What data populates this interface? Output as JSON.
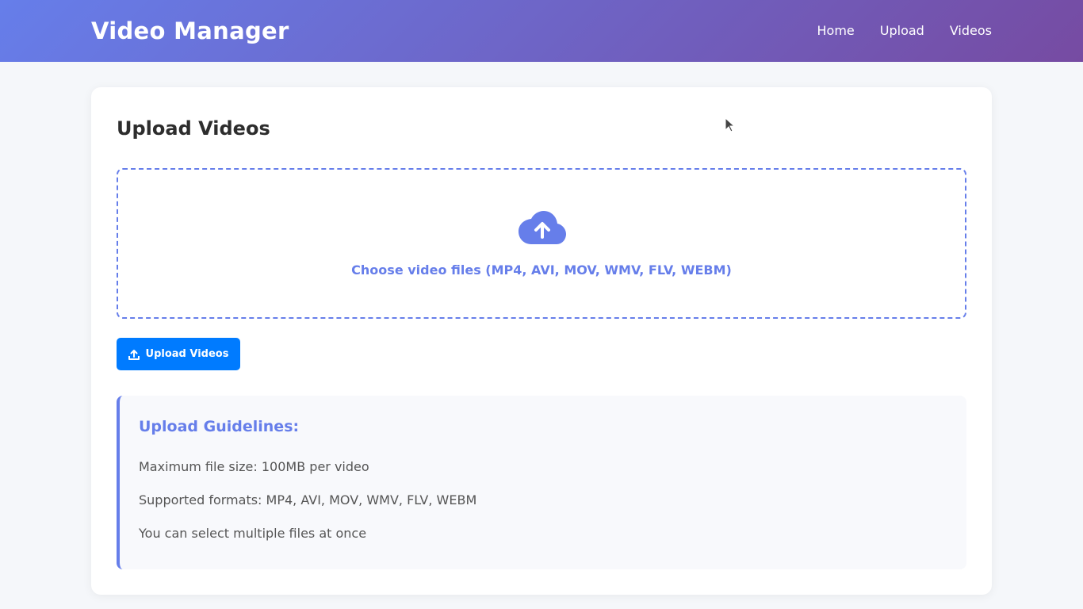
{
  "navbar": {
    "brand": "Video Manager",
    "links": [
      "Home",
      "Upload",
      "Videos"
    ]
  },
  "upload": {
    "title": "Upload Videos",
    "dropzone_label": "Choose video files (MP4, AVI, MOV, WMV, FLV, WEBM)",
    "dropzone_icon": "cloud-upload-icon",
    "button_label": "Upload Videos",
    "button_icon": "upload-icon"
  },
  "guidelines": {
    "title": "Upload Guidelines:",
    "items": [
      "Maximum file size: 100MB per video",
      "Supported formats: MP4, AVI, MOV, WMV, FLV, WEBM",
      "You can select multiple files at once"
    ]
  },
  "colors": {
    "accent": "#667eea",
    "gradient_end": "#764ba2",
    "button": "#007bff"
  }
}
